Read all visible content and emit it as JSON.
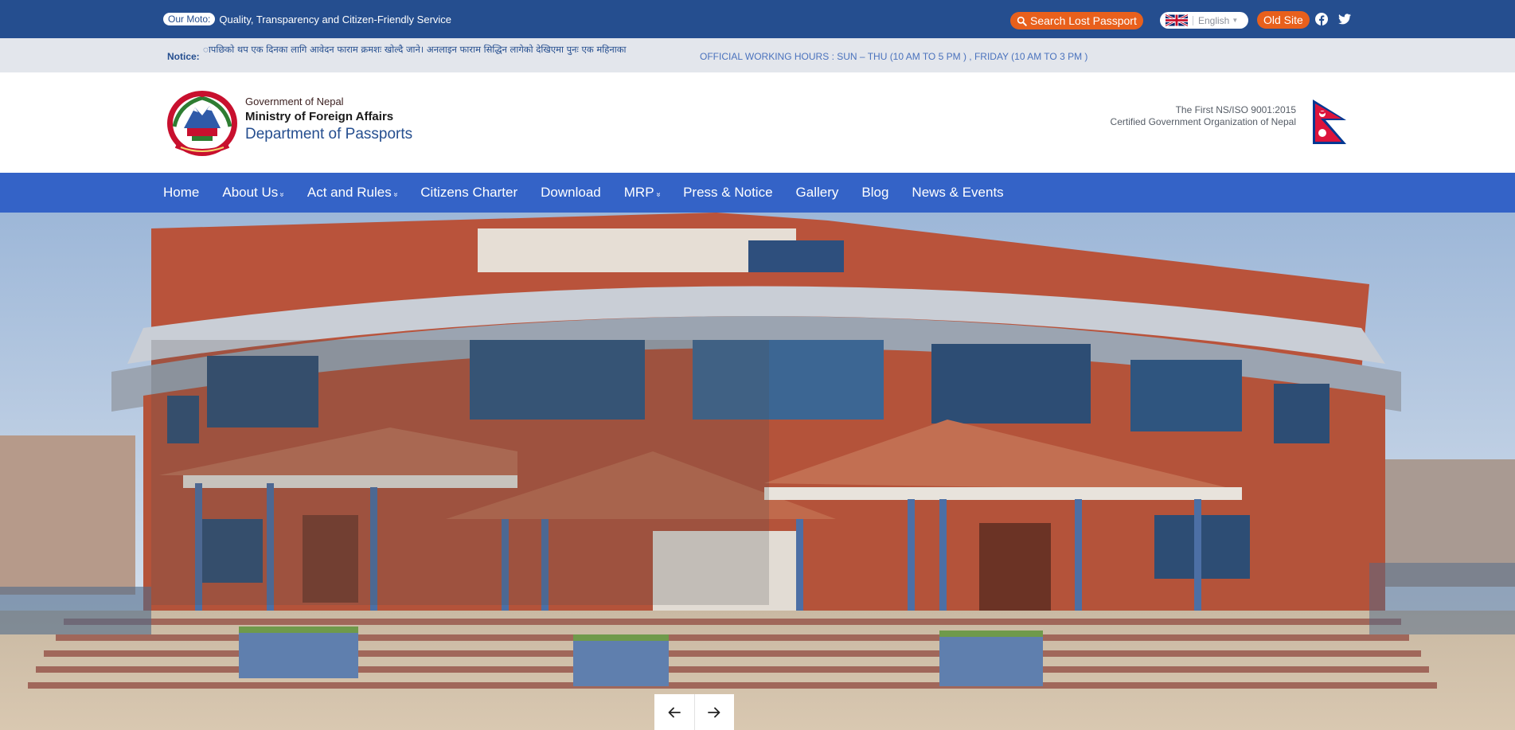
{
  "topbar": {
    "moto_label": "Our Moto:",
    "moto_text": "Quality, Transparency and Citizen-Friendly Service",
    "search_lost_passport": "Search Lost Passport",
    "language": "English",
    "old_site": "Old Site"
  },
  "notice": {
    "label": "Notice:",
    "text": "ापछिको थप एक दिनका लागि आवेदन फाराम क्रमशः खोल्दै जाने। अनलाइन फाराम सिद्धिन लागेको देखिएमा पुनः एक महिनाका",
    "hours": "OFFICIAL WORKING HOURS :  SUN – THU (10 AM TO 5 PM ) , FRIDAY (10 AM TO 3 PM )"
  },
  "header": {
    "government": "Government of Nepal",
    "ministry": "Ministry of Foreign Affairs",
    "department": "Department of Passports",
    "iso_line1": "The First NS/ISO 9001:2015",
    "iso_line2": "Certified Government Organization of Nepal"
  },
  "nav": {
    "items": [
      {
        "label": "Home",
        "dropdown": false
      },
      {
        "label": "About Us",
        "dropdown": true
      },
      {
        "label": "Act and Rules",
        "dropdown": true
      },
      {
        "label": "Citizens Charter",
        "dropdown": false
      },
      {
        "label": "Download",
        "dropdown": false
      },
      {
        "label": "MRP",
        "dropdown": true
      },
      {
        "label": "Press & Notice",
        "dropdown": false
      },
      {
        "label": "Gallery",
        "dropdown": false
      },
      {
        "label": "Blog",
        "dropdown": false
      },
      {
        "label": "News & Events",
        "dropdown": false
      }
    ],
    "dropdown_glyph": "»"
  },
  "icons": {
    "search": "search-icon",
    "facebook": "facebook-icon",
    "twitter": "twitter-icon",
    "prev": "arrow-left-icon",
    "next": "arrow-right-icon"
  },
  "colors": {
    "topbar": "#254e8f",
    "nav": "#3463c7",
    "accent_orange": "#e8601c",
    "notice_bg": "#e3e6ec"
  }
}
